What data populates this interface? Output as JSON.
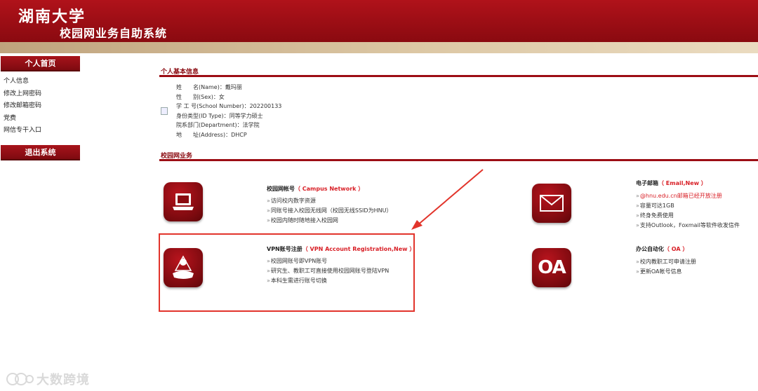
{
  "header": {
    "university": "湖南大学",
    "system_title": "校园网业务自助系统"
  },
  "sidebar": {
    "home_label": "个人首页",
    "items": [
      {
        "label": "个人信息"
      },
      {
        "label": "修改上网密码"
      },
      {
        "label": "修改邮箱密码"
      },
      {
        "label": "党费"
      },
      {
        "label": "网信专干入口"
      }
    ],
    "logout_label": "退出系统"
  },
  "personal": {
    "section_title": "个人基本信息",
    "fields": [
      {
        "label": "姓　　名(Name)：",
        "value": "戴玛丽"
      },
      {
        "label": "性　　别(Sex)：",
        "value": "女"
      },
      {
        "label": "学 工 号(School Number)：",
        "value": "202200133"
      },
      {
        "label": "身份类型(ID Type)：",
        "value": "同等学力硕士"
      },
      {
        "label": "院系部门(Department)：",
        "value": "法学院"
      },
      {
        "label": "地　　址(Address)：",
        "value": "DHCP"
      }
    ]
  },
  "services": {
    "section_title": "校园网业务",
    "campus": {
      "icon": "laptop-icon",
      "title_cn": "校园网帐号",
      "title_en": "（ Campus Network ）",
      "items": [
        "访问校内数字资源",
        "同账号接入校园无线网（校园无线SSID为HNU）",
        "校园内随时随地接入校园网"
      ]
    },
    "vpn": {
      "icon": "person-icon",
      "title_cn": "VPN账号注册",
      "title_en": "（ VPN Account Registration,New ）",
      "items": [
        "校园网账号即VPN账号",
        "研究生、教职工可直接使用校园网账号登陆VPN",
        "本科生需进行账号切换"
      ]
    },
    "email": {
      "icon": "envelope-icon",
      "title_cn": "电子邮箱",
      "title_en": "（ Email,New ）",
      "items": [
        "@hnu.edu.cn邮箱已经开放注册",
        "容量可达1GB",
        "终身免费使用",
        "支持Outlook，Foxmail等软件收发信件"
      ]
    },
    "oa": {
      "icon_text": "OA",
      "title_cn": "办公自动化",
      "title_en": "（ OA ）",
      "items": [
        "校内教职工可申请注册",
        "更新OA帐号信息"
      ]
    }
  },
  "watermark": {
    "text": "大数跨境"
  },
  "colors": {
    "brand_red": "#9c0d14",
    "highlight": "#e2342b",
    "tan": "#dcc7a4"
  }
}
